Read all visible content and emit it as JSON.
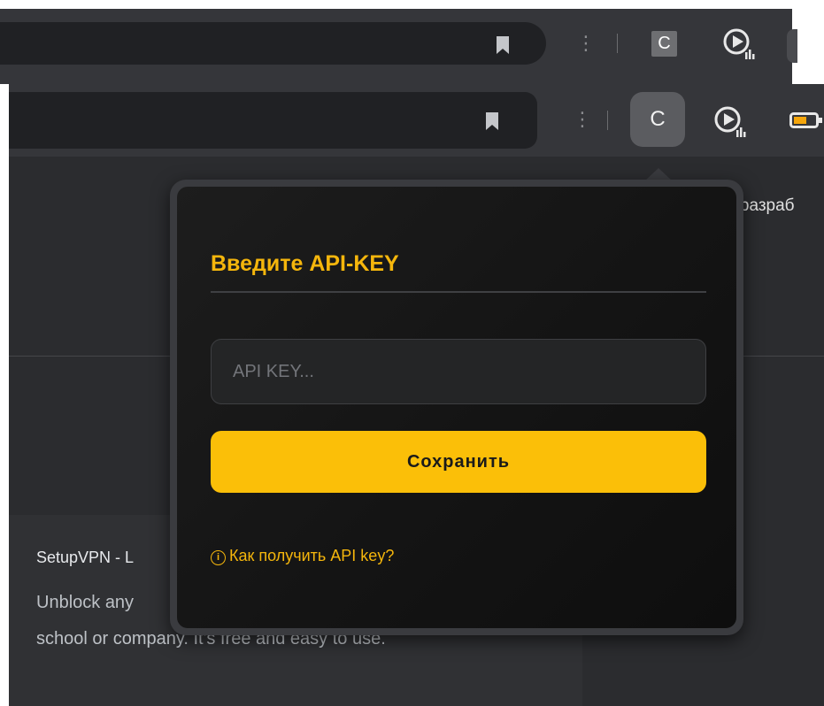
{
  "browser": {
    "extension_letter": "C",
    "more_icon_glyph": "⋮"
  },
  "page": {
    "side_text": "и разраб",
    "card": {
      "title": "SetupVPN - L",
      "desc_line1": "Unblock any",
      "desc_line2": "school or company. It's free and easy to use."
    }
  },
  "popup": {
    "title": "Введите API-KEY",
    "input": {
      "placeholder": "API KEY...",
      "value": ""
    },
    "save_label": "Сохранить",
    "help_icon": "i",
    "help_label": "Как получить API key?"
  },
  "colors": {
    "accent": "#f5b60c",
    "button": "#fbbf08",
    "toolbar": "#35363a",
    "omnibox": "#202124",
    "page_bg": "#2b2c2f"
  }
}
